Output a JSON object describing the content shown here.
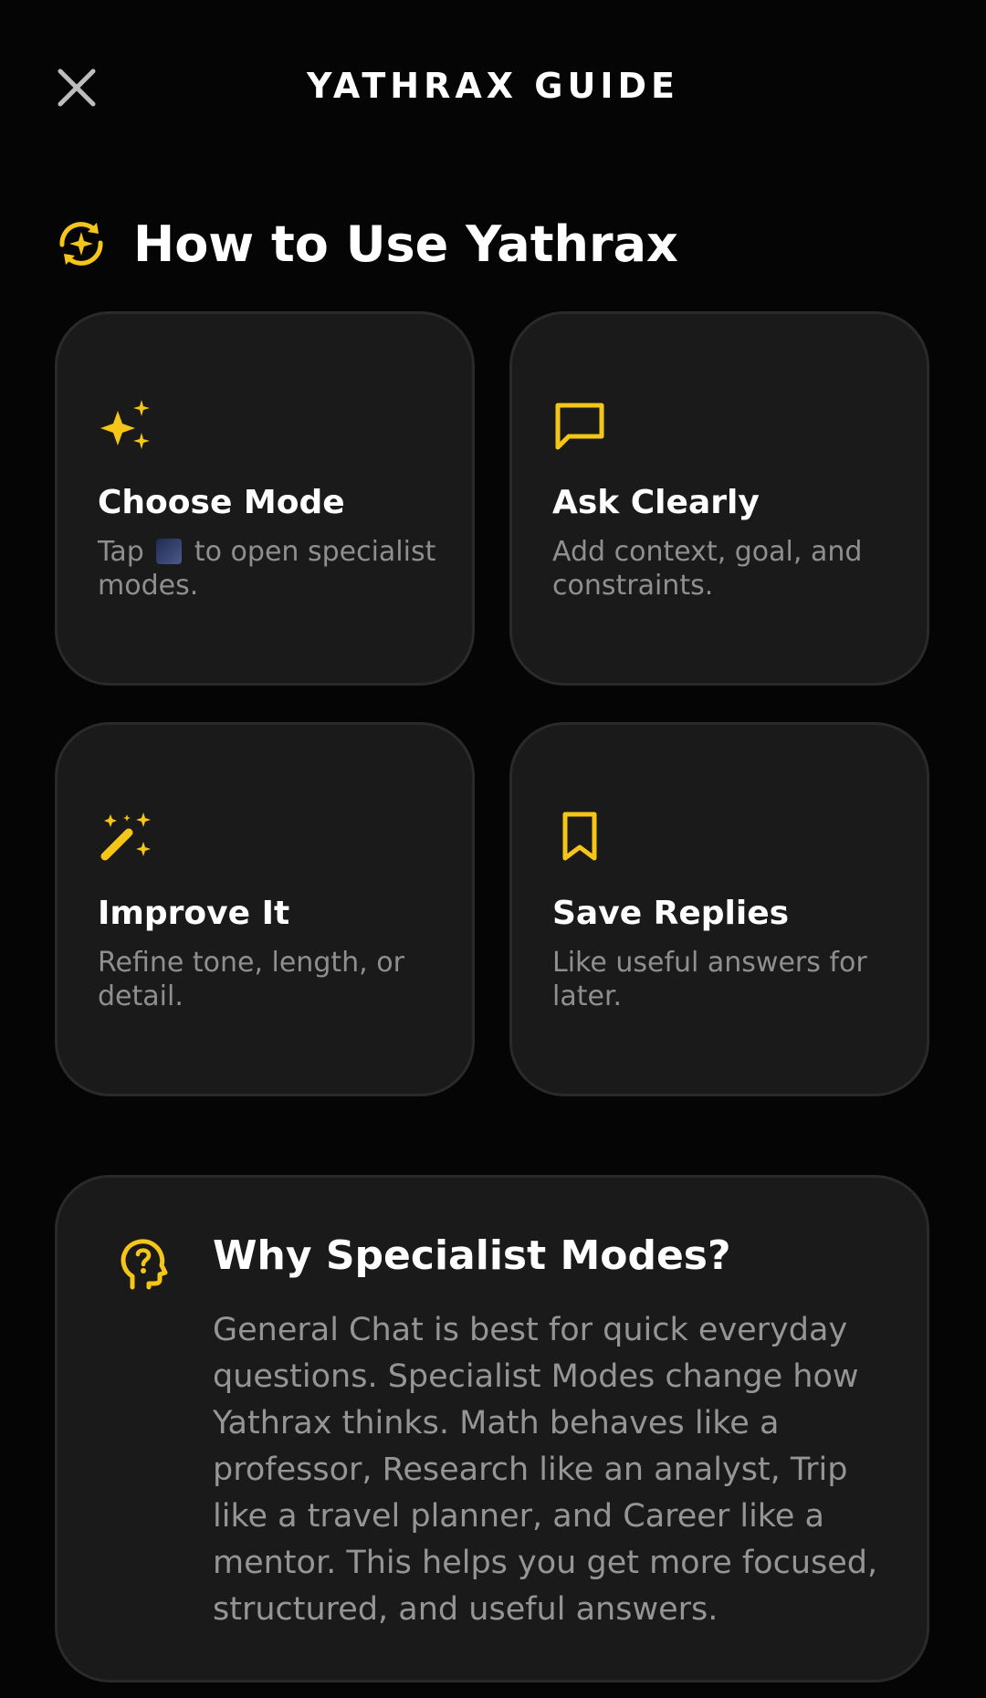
{
  "header": {
    "title": "YATHRAX GUIDE",
    "close_icon": "close-icon"
  },
  "section": {
    "title": "How to Use Yathrax",
    "icon": "sparkle-refresh-icon"
  },
  "cards": [
    {
      "title": "Choose Mode",
      "desc_before": "Tap",
      "desc_after": "to open specialist modes.",
      "icon": "sparkles-icon"
    },
    {
      "title": "Ask Clearly",
      "desc": "Add context, goal, and constraints.",
      "icon": "chat-bubble-icon"
    },
    {
      "title": "Improve It",
      "desc": "Refine tone, length, or detail.",
      "icon": "magic-wand-icon"
    },
    {
      "title": "Save Replies",
      "desc": "Like useful answers for later.",
      "icon": "bookmark-icon"
    }
  ],
  "info": {
    "title": "Why Specialist Modes?",
    "body": "General Chat is best for quick everyday questions. Specialist Modes change how Yathrax thinks. Math behaves like a professor, Research like an analyst, Trip like a travel planner, and Career like a mentor. This helps you get more focused, structured, and useful answers.",
    "icon": "head-question-icon"
  },
  "colors": {
    "accent": "#f5c518",
    "background": "#050505",
    "card": "#1a1a1a",
    "muted_text": "#8f8f8f"
  }
}
